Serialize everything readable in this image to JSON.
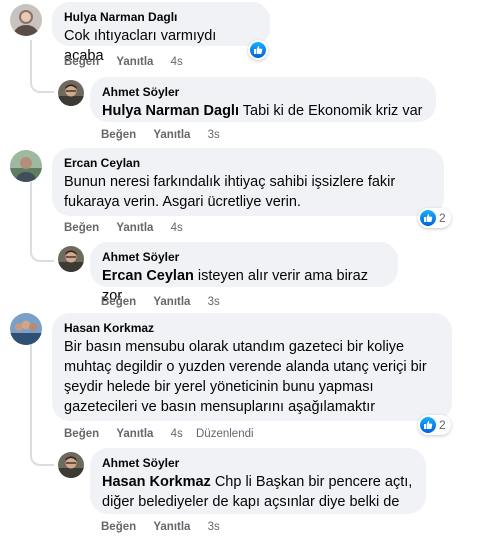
{
  "comments": [
    {
      "author": "Hulya Narman Daglı",
      "text": "Cok ıhtıyacları varmıydı acaba",
      "like_label": "Beğen",
      "reply_label": "Yanıtla",
      "time": "4s",
      "reactions": ""
    },
    {
      "author": "Ahmet Söyler",
      "mention": "Hulya Narman Daglı",
      "text": "Tabi ki de Ekonomik kriz var",
      "like_label": "Beğen",
      "reply_label": "Yanıtla",
      "time": "3s"
    },
    {
      "author": "Ercan Ceylan",
      "text_line1": "Bunun neresi farkındalık ihtiyaç sahibi işsizlere fakir",
      "text_line2": "fukaraya verin. Asgari ücretliye verin.",
      "like_label": "Beğen",
      "reply_label": "Yanıtla",
      "time": "4s",
      "reactions": "2"
    },
    {
      "author": "Ahmet Söyler",
      "mention": "Ercan Ceylan",
      "text": "isteyen alır verir ama biraz zor",
      "like_label": "Beğen",
      "reply_label": "Yanıtla",
      "time": "3s"
    },
    {
      "author": "Hasan Korkmaz",
      "text_line1": "Bir basın mensubu olarak utandım gazeteci bir koliye",
      "text_line2": "muhtaç degildir o yuzden verende alanda utanç veriçi bir",
      "text_line3": "şeydir helede bir yerel yöneticinin bunu yapması",
      "text_line4": "gazetecileri ve basın mensuplarını aşağılamaktır",
      "like_label": "Beğen",
      "reply_label": "Yanıtla",
      "time": "4s",
      "edited_label": "Düzenlendi",
      "reactions": "2"
    },
    {
      "author": "Ahmet Söyler",
      "mention": "Hasan Korkmaz",
      "text_line1": "Chp li Başkan bir pencere açtı,",
      "text_line2": "diğer belediyeler de kapı açsınlar diye belki de",
      "like_label": "Beğen",
      "reply_label": "Yanıtla",
      "time": "3s"
    }
  ],
  "icons": {
    "like": "like-icon",
    "avatar": "avatar"
  },
  "colors": {
    "bubble": "#f0f2f5",
    "meta": "#65676b",
    "like_blue": "#1877f2"
  }
}
